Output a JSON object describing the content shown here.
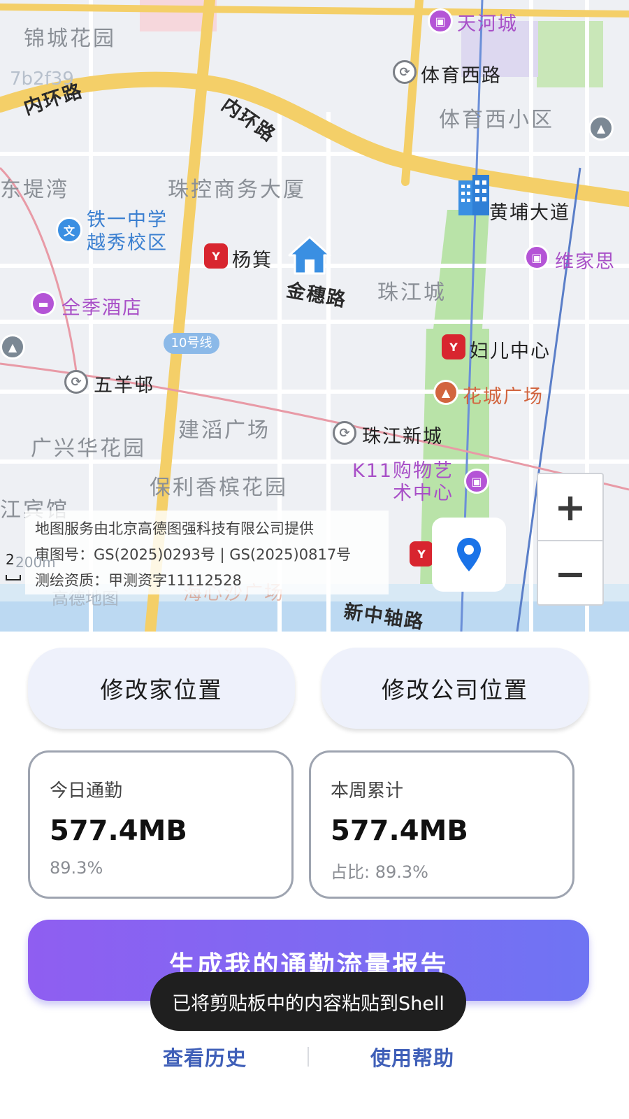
{
  "map": {
    "areas": [
      "锦城花园",
      "体育西小区",
      "东堤湾",
      "珠控商务大厦",
      "珠江城",
      "广兴华花园",
      "建滔广场",
      "保利香槟花园",
      "江宾馆"
    ],
    "roads": [
      "内环路",
      "内环路",
      "金穗路",
      "新中轴路"
    ],
    "watermark": "7b2f39",
    "pois": {
      "tianhe_city": "天河城",
      "tiyu_xilu": "体育西路",
      "huangpu_dadao": "黄埔大道",
      "weijiasi": "维家思",
      "tieyi_school": "铁一中学\n越秀校区",
      "yangji": "杨箕",
      "quanji_hotel": "全季酒店",
      "wuyang_cun": "五羊邨",
      "fuer_zhongxin": "妇儿中心",
      "huacheng_square": "花城广场",
      "zhujiang_xincheng": "珠江新城",
      "k11": "K11购物艺\n术中心",
      "haixinsha": "海心沙广场",
      "line10": "10号线"
    },
    "attribution": {
      "line1": "地图服务由北京高德图强科技有限公司提供",
      "line2": "审图号：GS(2025)0293号 | GS(2025)0817号",
      "line3": "测绘资质：甲测资字11112528"
    },
    "scale_label": "2",
    "scale_text": "200m",
    "amap_logo": "高德地图",
    "zoom_in": "+",
    "zoom_out": "−",
    "icons": {
      "home": "home-icon",
      "office": "office-building-icon",
      "locate": "location-pin-icon"
    }
  },
  "buttons": {
    "edit_home": "修改家位置",
    "edit_office": "修改公司位置",
    "generate_report": "生成我的通勤流量报告"
  },
  "stats": {
    "today": {
      "title": "今日通勤",
      "value": "577.4MB",
      "sub": "89.3%"
    },
    "week": {
      "title": "本周累计",
      "value": "577.4MB",
      "sub": "占比: 89.3%"
    }
  },
  "toast": "已将剪贴板中的内容粘贴到Shell",
  "footer": {
    "history": "查看历史",
    "help": "使用帮助"
  },
  "colors": {
    "accent_start": "#8f5ef1",
    "accent_end": "#6f74f3",
    "link": "#3f5fb8",
    "location_pin": "#1a73e8"
  }
}
